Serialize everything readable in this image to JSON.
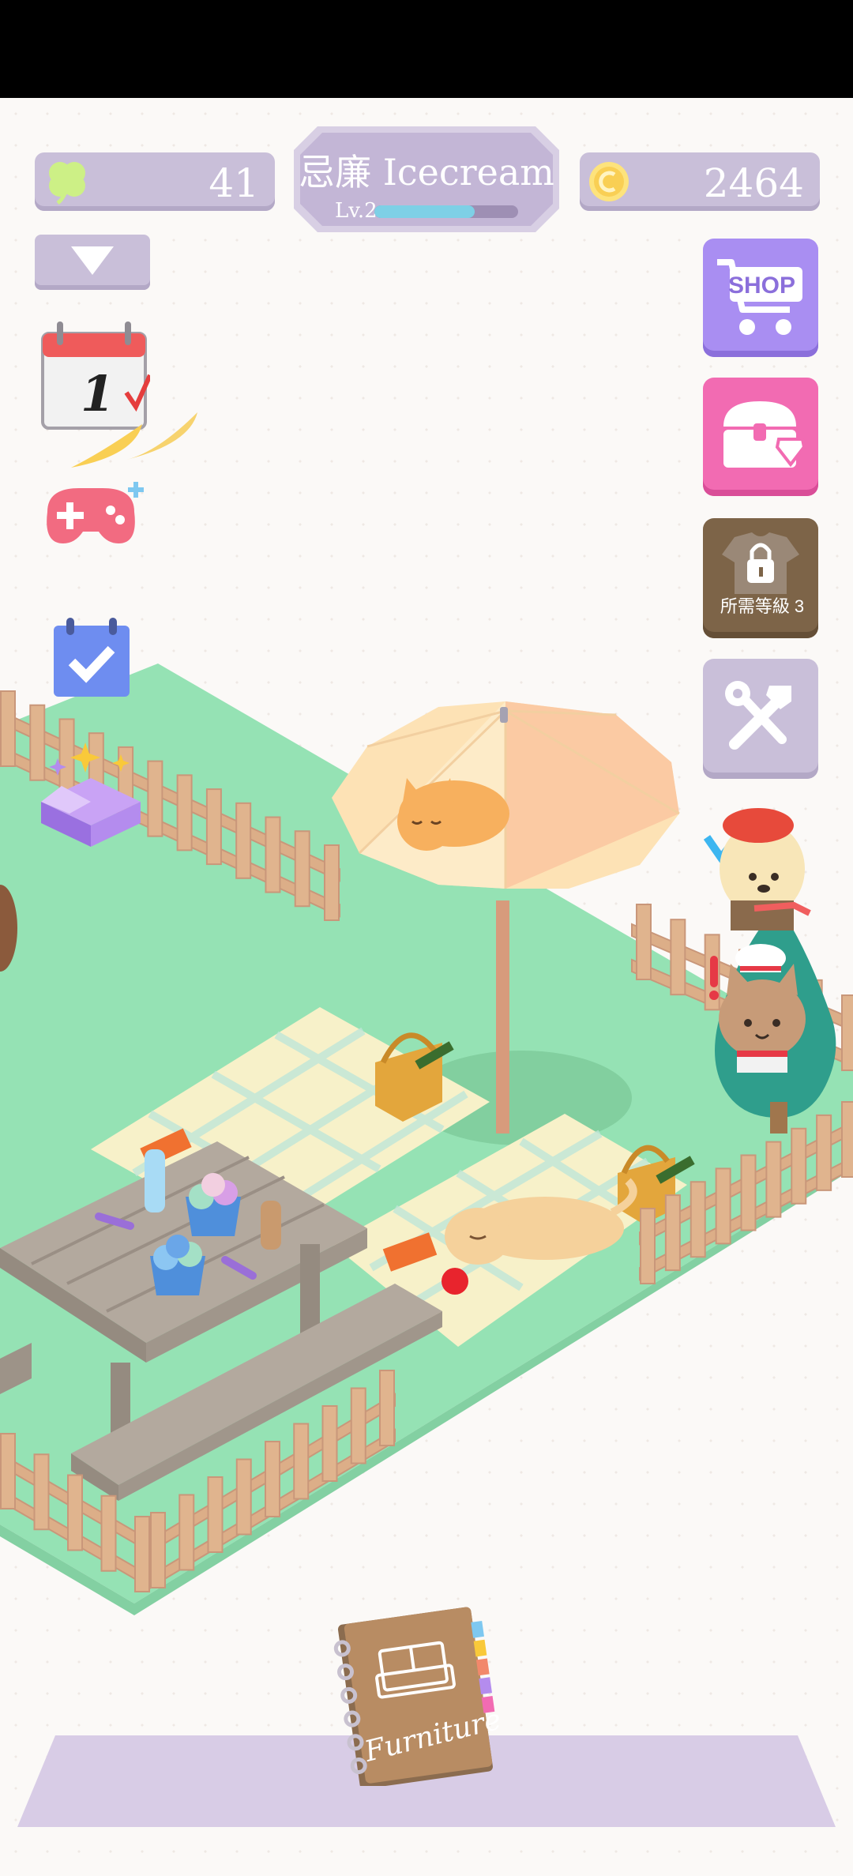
{
  "hud": {
    "clover_count": "41",
    "coin_count": "2464",
    "shop_title": "忌廉 Icecream",
    "level_label": "Lv.2",
    "level_progress": 0.7
  },
  "buttons": {
    "shop_label": "SHOP",
    "locked_label": "所需等級 3",
    "calendar_day": "1",
    "furniture_label": "Furniture"
  },
  "colors": {
    "grass": "#95e2b4",
    "fence": "#d9a982",
    "umbrella": "#fde2b5",
    "blanket": "#f7f1c9",
    "table": "#ada399",
    "shop_button": "#a98ef2",
    "treasure_button": "#f26bb2",
    "locked_button": "#7d6448",
    "tools_button": "#c9bfd9"
  },
  "icons": [
    "clover-icon",
    "coin-icon",
    "dropdown-arrow-icon",
    "calendar-icon",
    "gamepad-icon",
    "checklist-icon",
    "gift-box-icon",
    "shop-cart-icon",
    "treasure-chest-icon",
    "lock-shirt-icon",
    "tools-icon",
    "poodle-customer-icon",
    "cat-chef-icon",
    "furniture-book-icon"
  ]
}
